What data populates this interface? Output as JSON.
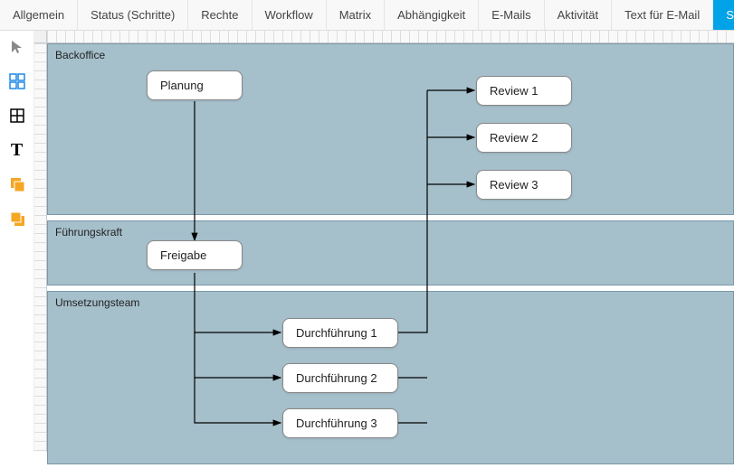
{
  "tabs": [
    {
      "label": "Allgemein"
    },
    {
      "label": "Status (Schritte)"
    },
    {
      "label": "Rechte"
    },
    {
      "label": "Workflow"
    },
    {
      "label": "Matrix"
    },
    {
      "label": "Abhängigkeit"
    },
    {
      "label": "E-Mails"
    },
    {
      "label": "Aktivität"
    },
    {
      "label": "Text für E-Mail"
    },
    {
      "label": "Status Workflow",
      "active": true
    }
  ],
  "tools": {
    "pointer": "pointer-icon",
    "grid4": "grid4-icon",
    "grid1": "grid1-icon",
    "text": "text-icon",
    "shape1": "shape-front-icon",
    "shape2": "shape-back-icon"
  },
  "lanes": {
    "backoffice": {
      "label": "Backoffice"
    },
    "fuehrungskraft": {
      "label": "Führungskraft"
    },
    "umsetzungsteam": {
      "label": "Umsetzungsteam"
    }
  },
  "nodes": {
    "planung": {
      "label": "Planung"
    },
    "freigabe": {
      "label": "Freigabe"
    },
    "durch1": {
      "label": "Durchführung 1"
    },
    "durch2": {
      "label": "Durchführung 2"
    },
    "durch3": {
      "label": "Durchführung 3"
    },
    "review1": {
      "label": "Review 1"
    },
    "review2": {
      "label": "Review 2"
    },
    "review3": {
      "label": "Review 3"
    }
  }
}
